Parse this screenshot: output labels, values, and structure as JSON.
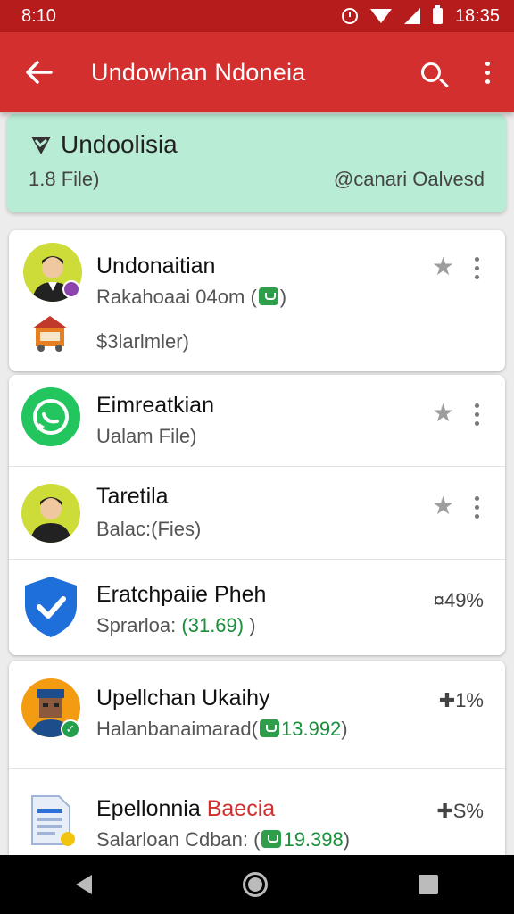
{
  "status": {
    "left_time": "8:10",
    "right_time": "18:35"
  },
  "appbar": {
    "title": "Undowhan Ndoneia",
    "back_icon": "arrow-back-icon",
    "search_icon": "search-icon",
    "menu_icon": "more-vert-icon"
  },
  "summary": {
    "title": "Undoolisia",
    "count": "1.8 File)",
    "right": "@canari Oalvesd"
  },
  "items": [
    {
      "name": "Undonaitian",
      "sub": "Rakahoaai 04om (",
      "sub_end": ")",
      "extra": "$3larlmler)"
    },
    {
      "name": "Eimreatkian",
      "sub": "Ualam File)"
    },
    {
      "name": "Taretila",
      "sub": "Balac:(Fies)"
    },
    {
      "name": "Eratchpaiie Pheh",
      "sub": "Sprarloa: ",
      "sub_green": "(31.69)",
      "sub_end": " )",
      "pct": "¤49%"
    },
    {
      "name": "Upellchan Ukaihy",
      "sub": "Halanbanaimarad(",
      "sub_green": "13.992",
      "sub_end": ")",
      "pct": "✚1%"
    },
    {
      "name_a": "Epellonnia",
      "name_b": "Baecia",
      "sub": "Salarloan Cdban: (",
      "sub_green": "19.398",
      "sub_end": ")",
      "pct": "✚S%"
    }
  ],
  "colors": {
    "appbar": "#d32f2f",
    "statusbar": "#b71c1c",
    "summary_bg": "#b9ecd5",
    "accent_green": "#1b8f3c"
  }
}
